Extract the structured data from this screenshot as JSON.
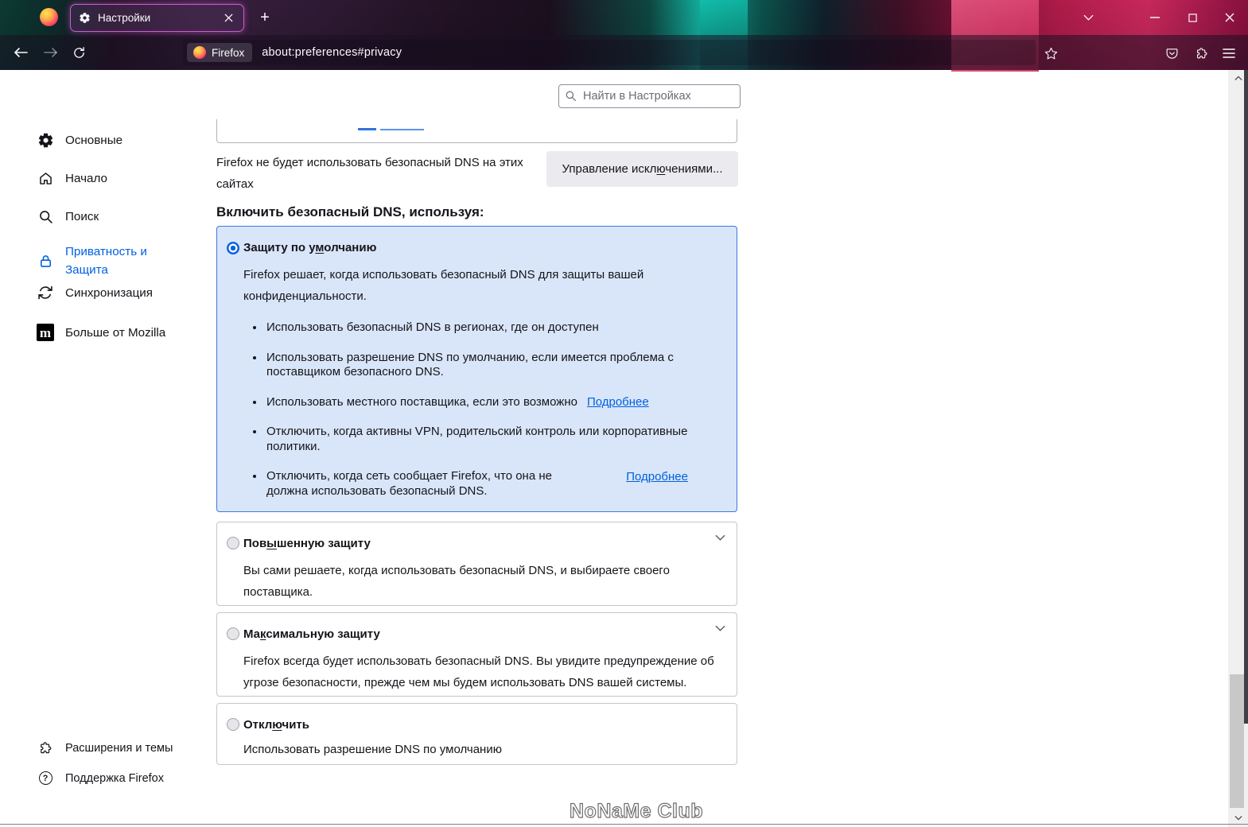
{
  "window": {
    "tab_title": "Настройки",
    "new_tab_label": "+",
    "url_chip": "Firefox",
    "url": "about:preferences#privacy"
  },
  "search": {
    "placeholder": "Найти в Настройках"
  },
  "sidebar": {
    "items": [
      {
        "label": "Основные",
        "icon": "gear"
      },
      {
        "label": "Начало",
        "icon": "home"
      },
      {
        "label": "Поиск",
        "icon": "search"
      },
      {
        "label": "Приватность и Защита",
        "icon": "lock",
        "active": true
      },
      {
        "label": "Синхронизация",
        "icon": "sync"
      },
      {
        "label": "Больше от Mozilla",
        "icon": "mozilla-m"
      }
    ],
    "mozilla_badge_letter": "m",
    "footer": [
      {
        "label": "Расширения и темы",
        "icon": "puzzle"
      },
      {
        "label": "Поддержка Firefox",
        "icon": "question",
        "icon_glyph": "?"
      }
    ]
  },
  "content": {
    "exceptions_note": "Firefox не будет использовать безопасный DNS на этих сайтах",
    "manage_button": {
      "pre": "Управление искл",
      "key": "ю",
      "post": "чениями..."
    },
    "heading": "Включить безопасный DNS, используя:",
    "options": [
      {
        "label": {
          "pre": "Защиту по у",
          "key": "м",
          "post": "олчанию"
        },
        "selected": true,
        "description": "Firefox решает, когда использовать безопасный DNS для защиты вашей конфиденциальности.",
        "bullets": [
          {
            "text": "Использовать безопасный DNS в регионах, где он доступен"
          },
          {
            "text": "Использовать разрешение DNS по умолчанию, если имеется проблема с поставщиком безопасного DNS."
          },
          {
            "text": "Использовать местного поставщика, если это возможно",
            "link": "Подробнее"
          },
          {
            "text": "Отключить, когда активны VPN, родительский контроль или корпоративные политики."
          },
          {
            "text": "Отключить, когда сеть сообщает Firefox, что она не должна использовать безопасный DNS.",
            "link": "Подробнее"
          }
        ]
      },
      {
        "label": {
          "pre": "Пов",
          "key": "ы",
          "post": "шенную защиту"
        },
        "selected": false,
        "description": "Вы сами решаете, когда использовать безопасный DNS, и выбираете своего поставщика."
      },
      {
        "label": {
          "pre": "Ма",
          "key": "к",
          "post": "симальную защиту"
        },
        "selected": false,
        "description": "Firefox всегда будет использовать безопасный DNS. Вы увидите предупреждение об угрозе безопасности, прежде чем мы будем использовать DNS вашей системы."
      },
      {
        "label": {
          "pre": "Откл",
          "key": "ю",
          "post": "чить"
        },
        "selected": false,
        "description": "Использовать разрешение DNS по умолчанию"
      }
    ]
  },
  "watermark": "NoNaMe Club",
  "colors": {
    "accent_blue": "#0a62e0",
    "link_blue": "#0060df",
    "selected_panel_bg": "#d9e6f9",
    "selected_panel_border": "#3c79dd"
  }
}
